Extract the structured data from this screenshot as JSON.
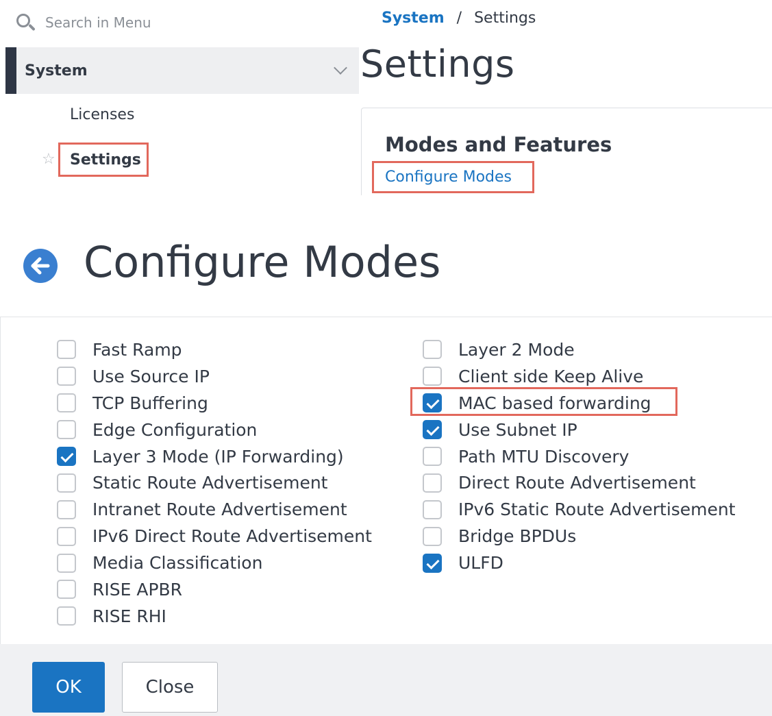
{
  "search": {
    "placeholder": "Search in Menu"
  },
  "menu": {
    "section_label": "System",
    "items": [
      {
        "label": "Licenses"
      },
      {
        "label": "Settings"
      }
    ]
  },
  "breadcrumb": {
    "parent": "System",
    "separator": "/",
    "current": "Settings"
  },
  "page": {
    "title": "Settings"
  },
  "card": {
    "title": "Modes and Features",
    "link_label": "Configure Modes"
  },
  "dialog": {
    "title": "Configure Modes",
    "left_modes": [
      {
        "label": "Fast Ramp",
        "checked": false
      },
      {
        "label": "Use Source IP",
        "checked": false
      },
      {
        "label": "TCP Buffering",
        "checked": false
      },
      {
        "label": "Edge Configuration",
        "checked": false
      },
      {
        "label": "Layer 3 Mode (IP Forwarding)",
        "checked": true
      },
      {
        "label": "Static Route Advertisement",
        "checked": false
      },
      {
        "label": "Intranet Route Advertisement",
        "checked": false
      },
      {
        "label": "IPv6 Direct Route Advertisement",
        "checked": false
      },
      {
        "label": "Media Classification",
        "checked": false
      },
      {
        "label": "RISE APBR",
        "checked": false
      },
      {
        "label": "RISE RHI",
        "checked": false
      }
    ],
    "right_modes": [
      {
        "label": "Layer 2 Mode",
        "checked": false
      },
      {
        "label": "Client side Keep Alive",
        "checked": false
      },
      {
        "label": "MAC based forwarding",
        "checked": true
      },
      {
        "label": "Use Subnet IP",
        "checked": true
      },
      {
        "label": "Path MTU Discovery",
        "checked": false
      },
      {
        "label": "Direct Route Advertisement",
        "checked": false
      },
      {
        "label": "IPv6 Static Route Advertisement",
        "checked": false
      },
      {
        "label": "Bridge BPDUs",
        "checked": false
      },
      {
        "label": "ULFD",
        "checked": true
      }
    ],
    "ok_label": "OK",
    "close_label": "Close"
  },
  "colors": {
    "accent": "#1a74c2",
    "highlight": "#e2685c",
    "nav_bar": "#2e3645"
  }
}
